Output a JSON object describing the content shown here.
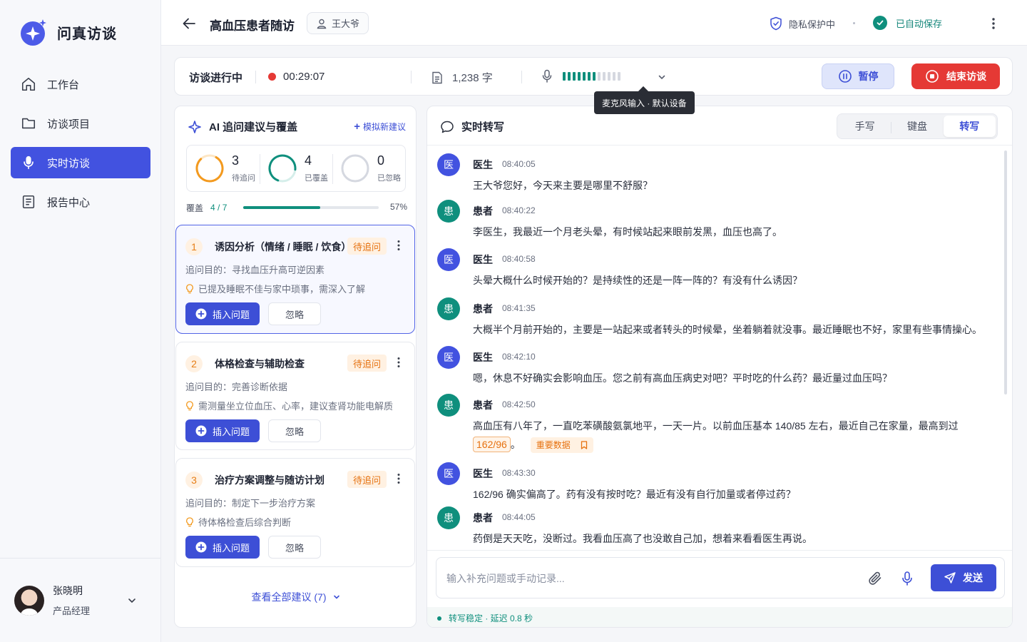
{
  "app": {
    "name": "问真访谈"
  },
  "sidebar": {
    "items": [
      {
        "label": "工作台",
        "icon": "home-icon"
      },
      {
        "label": "访谈项目",
        "icon": "folder-icon"
      },
      {
        "label": "实时访谈",
        "icon": "microphone-icon",
        "active": true
      },
      {
        "label": "报告中心",
        "icon": "report-icon"
      }
    ],
    "user": {
      "name": "张晓明",
      "role": "产品经理"
    }
  },
  "header": {
    "title": "高血压患者随访",
    "patient": "王大爷",
    "privacy": "隐私保护中",
    "saved": "已自动保存"
  },
  "status": {
    "label": "访谈进行中",
    "timer": "00:29:07",
    "word_count": "1,238 字",
    "mic_level": 0.58,
    "mic_tooltip": "麦克风输入 · 默认设备",
    "pause_label": "暂停",
    "end_label": "结束访谈"
  },
  "suggestions": {
    "title": "AI 追问建议与覆盖",
    "new_label": "模拟新建议",
    "stats": [
      {
        "value": "3",
        "caption": "待追问",
        "color": "#f39a1f"
      },
      {
        "value": "4",
        "caption": "已覆盖",
        "color": "#0f8f7d"
      },
      {
        "value": "0",
        "caption": "已忽略",
        "color": "#d5d8e0"
      }
    ],
    "coverage": {
      "label": "覆盖",
      "fraction": "4 / 7",
      "percent": "57%",
      "value": 0.57
    },
    "cards": [
      {
        "index": "1",
        "title": "诱因分析（情绪 / 睡眠 / 饮食）",
        "status": "待追问",
        "purpose": "追问目的：寻找血压升高可逆因素",
        "hint": "已提及睡眠不佳与家中琐事，需深入了解",
        "insert": "插入问题",
        "ignore": "忽略"
      },
      {
        "index": "2",
        "title": "体格检查与辅助检查",
        "status": "待追问",
        "purpose": "追问目的：完善诊断依据",
        "hint": "需测量坐立位血压、心率，建议查肾功能电解质",
        "insert": "插入问题",
        "ignore": "忽略"
      },
      {
        "index": "3",
        "title": "治疗方案调整与随访计划",
        "status": "待追问",
        "purpose": "追问目的：制定下一步治疗方案",
        "hint": "待体格检查后综合判断",
        "insert": "插入问题",
        "ignore": "忽略"
      }
    ],
    "view_all": "查看全部建议 (7)"
  },
  "transcript": {
    "title": "实时转写",
    "modes": [
      "手写",
      "键盘",
      "转写"
    ],
    "active_mode": "转写",
    "messages": [
      {
        "avatar": "医",
        "role": "医生",
        "time": "08:40:05",
        "text": "王大爷您好，今天来主要是哪里不舒服？"
      },
      {
        "avatar": "患",
        "role": "患者",
        "time": "08:40:22",
        "text": "李医生，我最近一个月老头晕，有时候站起来眼前发黑，血压也高了。"
      },
      {
        "avatar": "医",
        "role": "医生",
        "time": "08:40:58",
        "text": "头晕大概什么时候开始的？是持续性的还是一阵一阵的？有没有什么诱因？"
      },
      {
        "avatar": "患",
        "role": "患者",
        "time": "08:41:35",
        "text": "大概半个月前开始的，主要是一站起来或者转头的时候晕，坐着躺着就没事。最近睡眠也不好，家里有些事情操心。"
      },
      {
        "avatar": "医",
        "role": "医生",
        "time": "08:42:10",
        "text": "嗯，休息不好确实会影响血压。您之前有高血压病史对吧？平时吃的什么药？最近量过血压吗？"
      },
      {
        "avatar": "患",
        "role": "患者",
        "time": "08:42:50",
        "text": "高血压有八年了，一直吃苯磺酸氨氯地平，一天一片。以前血压基本 140/85 左右，最近自己在家量，最高到过",
        "highlight": "162/96",
        "after": "。",
        "tag": "重要数据"
      },
      {
        "avatar": "医",
        "role": "医生",
        "time": "08:43:30",
        "text": "162/96 确实偏高了。药有没有按时吃？最近有没有自行加量或者停过药？"
      },
      {
        "avatar": "患",
        "role": "患者",
        "time": "08:44:05",
        "text": "药倒是天天吃，没断过。我看血压高了也没敢自己加，想着来看看医生再说。"
      }
    ],
    "composer_placeholder": "输入补充问题或手动记录...",
    "send_label": "发送",
    "footer": "转写稳定 · 延迟 0.8 秒"
  },
  "colors": {
    "primary": "#3d4fd6",
    "teal": "#0f8f7d",
    "danger": "#e53935",
    "warning": "#e6710f"
  }
}
